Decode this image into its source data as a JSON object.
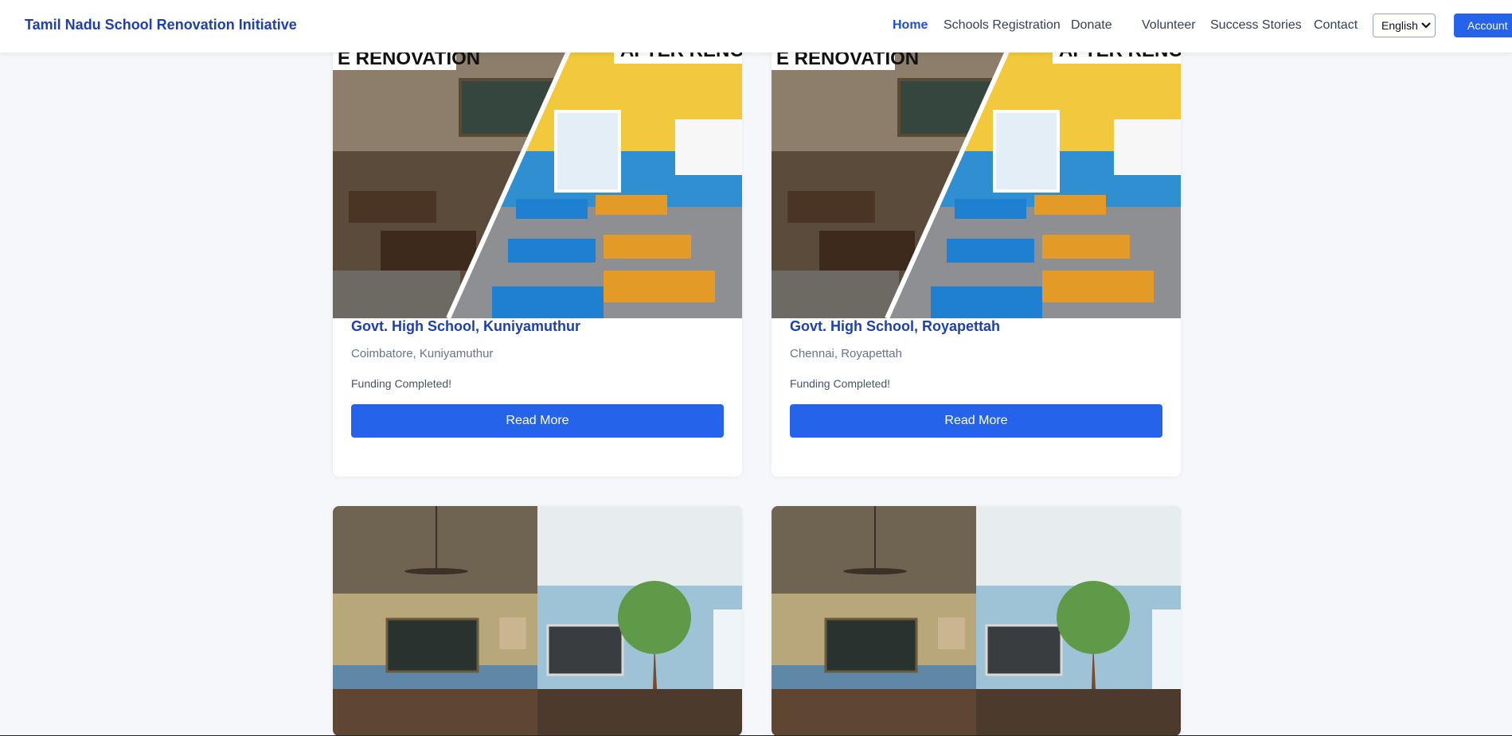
{
  "nav": {
    "brand": "Tamil Nadu School Renovation Initiative",
    "links": [
      "Home",
      "Schools Registration",
      "Donate",
      "Volunteer",
      "Success Stories",
      "Contact"
    ],
    "language": "English",
    "account": "Account"
  },
  "cards": [
    {
      "title": "Govt. High School, Kuniyamuthur",
      "location": "Coimbatore, Kuniyamuthur",
      "status": "Funding Completed!",
      "button": "Read More",
      "image_labels": {
        "before": "E RENOVATION",
        "after": "AFTER RENOVA"
      }
    },
    {
      "title": "Govt. High School, Royapettah",
      "location": "Chennai, Royapettah",
      "status": "Funding Completed!",
      "button": "Read More",
      "image_labels": {
        "before": "E RENOVATION",
        "after": "AFTER RENOVA"
      }
    }
  ],
  "colors": {
    "brand": "#1e40af",
    "accent": "#2563eb",
    "background": "#f5f7fb"
  }
}
